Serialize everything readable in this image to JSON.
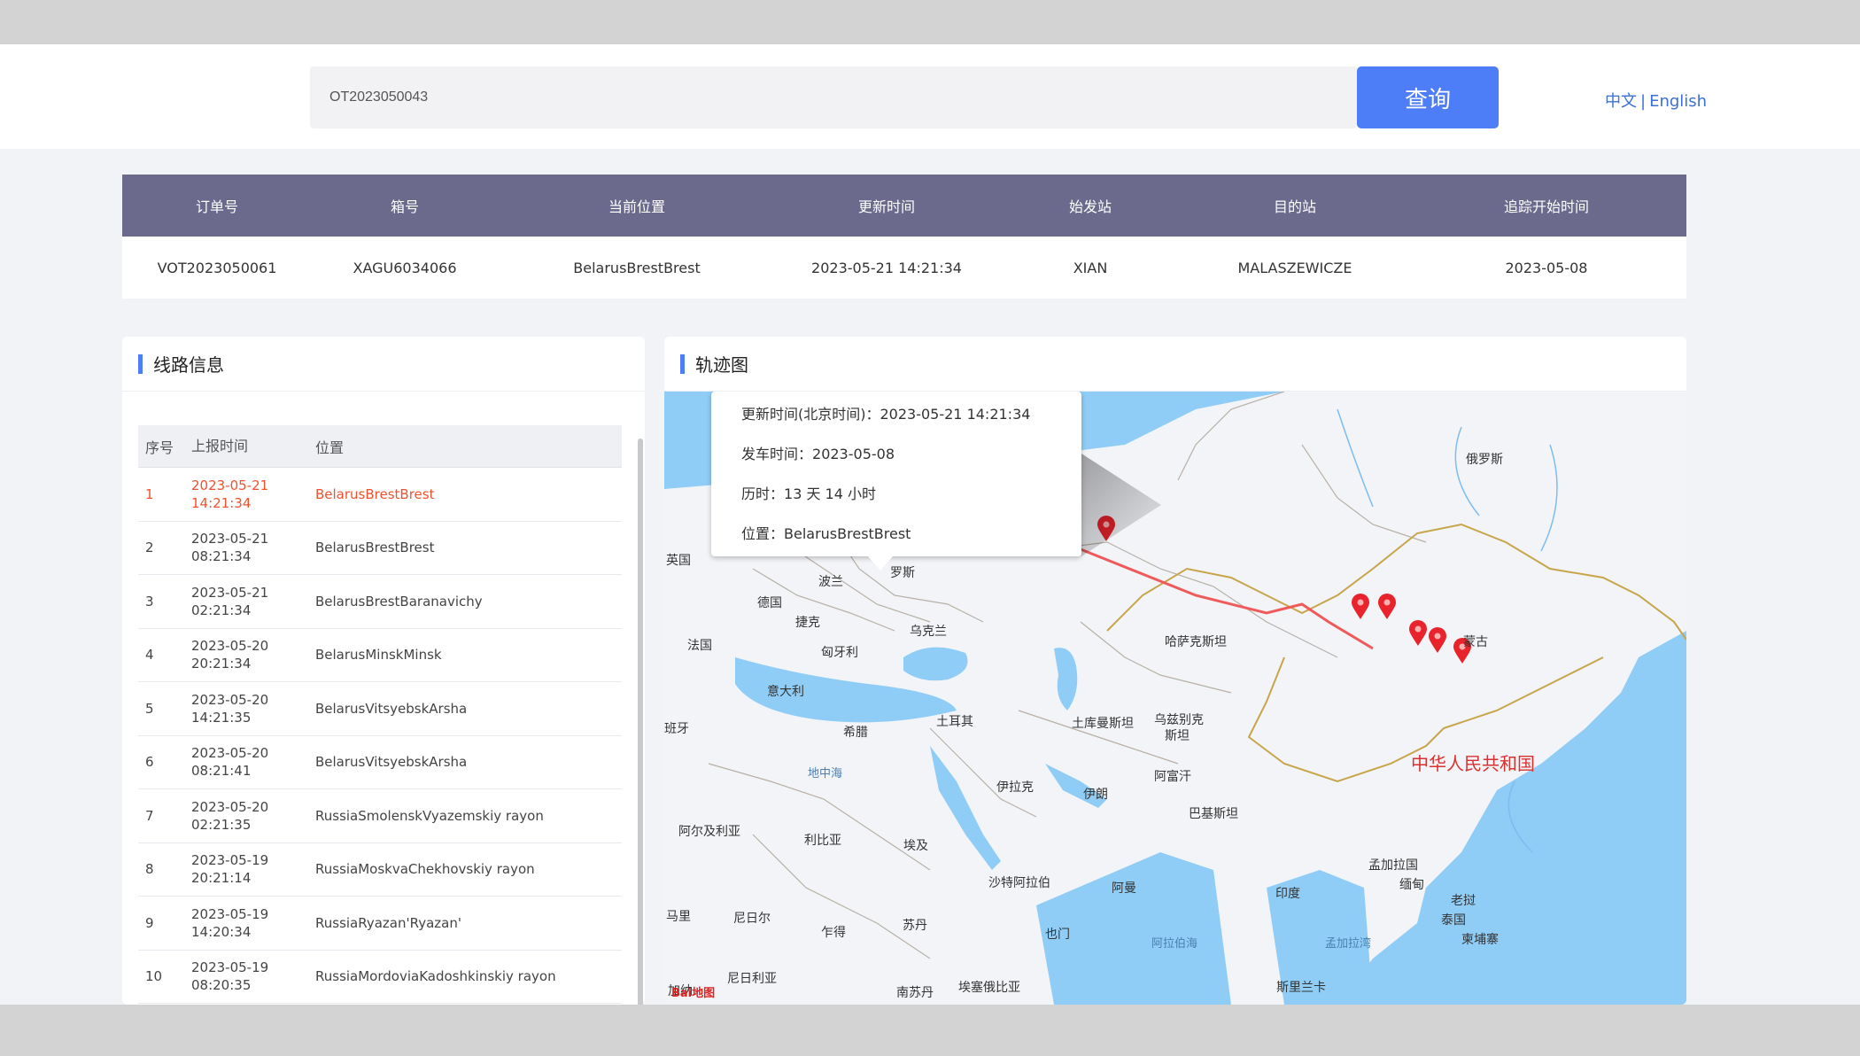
{
  "search": {
    "value": "OT2023050043",
    "button_label": "查询"
  },
  "language": {
    "zh": "中文",
    "separator": "|",
    "en": "English"
  },
  "order": {
    "headers": [
      "订单号",
      "箱号",
      "当前位置",
      "更新时间",
      "始发站",
      "目的站",
      "追踪开始时间"
    ],
    "values": [
      "VOT2023050061",
      "XAGU6034066",
      "BelarusBrestBrest",
      "2023-05-21 14:21:34",
      "XIAN",
      "MALASZEWICZE",
      "2023-05-08"
    ]
  },
  "route": {
    "title": "线路信息",
    "headers": {
      "no": "序号",
      "time": "上报时间",
      "location": "位置"
    },
    "rows": [
      {
        "no": "1",
        "date": "2023-05-21",
        "time": "14:21:34",
        "location": "BelarusBrestBrest"
      },
      {
        "no": "2",
        "date": "2023-05-21",
        "time": "08:21:34",
        "location": "BelarusBrestBrest"
      },
      {
        "no": "3",
        "date": "2023-05-21",
        "time": "02:21:34",
        "location": "BelarusBrestBaranavichy"
      },
      {
        "no": "4",
        "date": "2023-05-20",
        "time": "20:21:34",
        "location": "BelarusMinskMinsk"
      },
      {
        "no": "5",
        "date": "2023-05-20",
        "time": "14:21:35",
        "location": "BelarusVitsyebskArsha"
      },
      {
        "no": "6",
        "date": "2023-05-20",
        "time": "08:21:41",
        "location": "BelarusVitsyebskArsha"
      },
      {
        "no": "7",
        "date": "2023-05-20",
        "time": "02:21:35",
        "location": "RussiaSmolenskVyazemskiy rayon"
      },
      {
        "no": "8",
        "date": "2023-05-19",
        "time": "20:21:14",
        "location": "RussiaMoskvaChekhovskiy rayon"
      },
      {
        "no": "9",
        "date": "2023-05-19",
        "time": "14:20:34",
        "location": "RussiaRyazan'Ryazan'"
      },
      {
        "no": "10",
        "date": "2023-05-19",
        "time": "08:20:35",
        "location": "RussiaMordoviaKadoshkinskiy rayon"
      }
    ]
  },
  "map": {
    "title": "轨迹图",
    "popup": {
      "update_label": "更新时间(北京时间)：",
      "update_value": "2023-05-21 14:21:34",
      "depart_label": "发车时间：",
      "depart_value": "2023-05-08",
      "duration_label": "历时：",
      "duration_value": "13 天 14 小时",
      "location_label": "位置：",
      "location_value": "BelarusBrestBrest"
    },
    "labels": {
      "russia": "俄罗斯",
      "uk": "英国",
      "poland": "波兰",
      "belarus_partial": "罗斯",
      "germany": "德国",
      "czech": "捷克",
      "ukraine": "乌克兰",
      "france": "法国",
      "hungary": "匈牙利",
      "kazakhstan": "哈萨克斯坦",
      "mongolia": "蒙古",
      "italy": "意大利",
      "spain_partial": "班牙",
      "greece": "希腊",
      "turkey": "土耳其",
      "turkmenistan": "土库曼斯坦",
      "uzbekistan_1": "乌兹别克",
      "uzbekistan_2": "斯坦",
      "china": "中华人民共和国",
      "med_sea": "地中海",
      "syria": "伊拉克",
      "iran": "伊朗",
      "afghanistan": "阿富汗",
      "pakistan": "巴基斯坦",
      "algeria": "阿尔及利亚",
      "libya": "利比亚",
      "egypt": "埃及",
      "saudi": "沙特阿拉伯",
      "oman": "阿曼",
      "bangladesh": "孟加拉国",
      "myanmar": "缅甸",
      "india": "印度",
      "laos": "老挝",
      "thailand": "泰国",
      "cambodia": "柬埔寨",
      "mali": "马里",
      "niger": "尼日尔",
      "chad": "乍得",
      "sudan": "苏丹",
      "yemen": "也门",
      "arabian_sea": "阿拉伯海",
      "bay_bengal": "孟加拉湾",
      "nigeria": "尼日利亚",
      "south_sudan": "南苏丹",
      "ethiopia": "埃塞俄比亚",
      "sri_lanka": "斯里兰卡",
      "ghana_partial": "加纳",
      "baidu_map": "Bai地图"
    }
  }
}
